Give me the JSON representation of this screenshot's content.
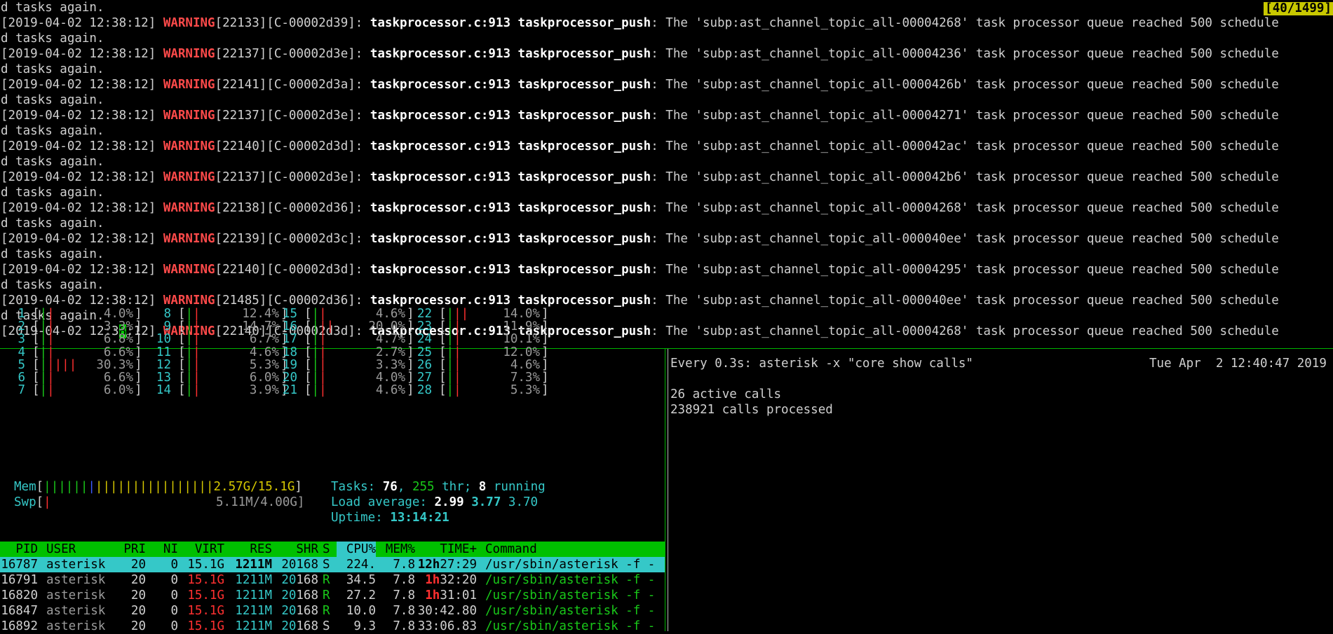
{
  "log": {
    "position_badge": "[40/1499]",
    "first_line": "d tasks again.",
    "wrap_tail": "d tasks again.",
    "entries": [
      {
        "ts": "[2019-04-02 12:38:12]",
        "level": "WARNING",
        "ids": "[22133][C-00002d39]:",
        "src": "taskprocessor.c:913 taskprocessor_push",
        "msg": ": The 'subp:ast_channel_topic_all-00004268' task processor queue reached 500 schedule"
      },
      {
        "ts": "[2019-04-02 12:38:12]",
        "level": "WARNING",
        "ids": "[22137][C-00002d3e]:",
        "src": "taskprocessor.c:913 taskprocessor_push",
        "msg": ": The 'subp:ast_channel_topic_all-00004236' task processor queue reached 500 schedule"
      },
      {
        "ts": "[2019-04-02 12:38:12]",
        "level": "WARNING",
        "ids": "[22141][C-00002d3a]:",
        "src": "taskprocessor.c:913 taskprocessor_push",
        "msg": ": The 'subp:ast_channel_topic_all-0000426b' task processor queue reached 500 schedule"
      },
      {
        "ts": "[2019-04-02 12:38:12]",
        "level": "WARNING",
        "ids": "[22137][C-00002d3e]:",
        "src": "taskprocessor.c:913 taskprocessor_push",
        "msg": ": The 'subp:ast_channel_topic_all-00004271' task processor queue reached 500 schedule"
      },
      {
        "ts": "[2019-04-02 12:38:12]",
        "level": "WARNING",
        "ids": "[22140][C-00002d3d]:",
        "src": "taskprocessor.c:913 taskprocessor_push",
        "msg": ": The 'subp:ast_channel_topic_all-000042ac' task processor queue reached 500 schedule"
      },
      {
        "ts": "[2019-04-02 12:38:12]",
        "level": "WARNING",
        "ids": "[22137][C-00002d3e]:",
        "src": "taskprocessor.c:913 taskprocessor_push",
        "msg": ": The 'subp:ast_channel_topic_all-000042b6' task processor queue reached 500 schedule"
      },
      {
        "ts": "[2019-04-02 12:38:12]",
        "level": "WARNING",
        "ids": "[22138][C-00002d36]:",
        "src": "taskprocessor.c:913 taskprocessor_push",
        "msg": ": The 'subp:ast_channel_topic_all-00004268' task processor queue reached 500 schedule"
      },
      {
        "ts": "[2019-04-02 12:38:12]",
        "level": "WARNING",
        "ids": "[22139][C-00002d3c]:",
        "src": "taskprocessor.c:913 taskprocessor_push",
        "msg": ": The 'subp:ast_channel_topic_all-000040ee' task processor queue reached 500 schedule"
      },
      {
        "ts": "[2019-04-02 12:38:12]",
        "level": "WARNING",
        "ids": "[22140][C-00002d3d]:",
        "src": "taskprocessor.c:913 taskprocessor_push",
        "msg": ": The 'subp:ast_channel_topic_all-00004295' task processor queue reached 500 schedule"
      },
      {
        "ts": "[2019-04-02 12:38:12]",
        "level": "WARNING",
        "ids": "[21485][C-00002d36]:",
        "src": "taskprocessor.c:913 taskprocessor_push",
        "msg": ": The 'subp:ast_channel_topic_all-000040ee' task processor queue reached 500 schedule"
      }
    ],
    "last_entry": {
      "ts_a": "[2019-04-02 12:3",
      "ts_cursor": "8",
      "ts_b": ":12]",
      "level": "WARNING",
      "ids": "[22140][C-00002d3d]:",
      "src": "taskprocessor.c:913 taskprocessor_push",
      "msg": ": The 'subp:ast_channel_topic_all-00004268' task processor queue reached 500 schedule"
    }
  },
  "htop": {
    "cpus": [
      {
        "n": "1",
        "bar": "||",
        "pct": "4.0%"
      },
      {
        "n": "2",
        "bar": "||",
        "pct": "3.3%"
      },
      {
        "n": "3",
        "bar": "||",
        "pct": "6.8%"
      },
      {
        "n": "4",
        "bar": "||",
        "pct": "6.6%"
      },
      {
        "n": "5",
        "bar": "|||||",
        "pct": "30.3%"
      },
      {
        "n": "6",
        "bar": "||",
        "pct": "6.6%"
      },
      {
        "n": "7",
        "bar": "||",
        "pct": "6.0%"
      },
      {
        "n": "8",
        "bar": "||",
        "pct": "12.4%"
      },
      {
        "n": "9",
        "bar": "||",
        "pct": "14.7%"
      },
      {
        "n": "10",
        "bar": "||",
        "pct": "6.7%"
      },
      {
        "n": "11",
        "bar": "||",
        "pct": "4.6%"
      },
      {
        "n": "12",
        "bar": "||",
        "pct": "5.3%"
      },
      {
        "n": "13",
        "bar": "||",
        "pct": "6.0%"
      },
      {
        "n": "14",
        "bar": "||",
        "pct": "3.9%"
      },
      {
        "n": "15",
        "bar": "||",
        "pct": "4.6%"
      },
      {
        "n": "16",
        "bar": "|||",
        "pct": "20.0%"
      },
      {
        "n": "17",
        "bar": "||",
        "pct": "4.7%"
      },
      {
        "n": "18",
        "bar": "||",
        "pct": "2.7%"
      },
      {
        "n": "19",
        "bar": "||",
        "pct": "3.3%"
      },
      {
        "n": "20",
        "bar": "||",
        "pct": "4.0%"
      },
      {
        "n": "21",
        "bar": "||",
        "pct": "4.6%"
      },
      {
        "n": "22",
        "bar": "|||",
        "pct": "14.0%"
      },
      {
        "n": "23",
        "bar": "||",
        "pct": "11.9%"
      },
      {
        "n": "24",
        "bar": "||",
        "pct": "10.1%"
      },
      {
        "n": "25",
        "bar": "||",
        "pct": "12.0%"
      },
      {
        "n": "26",
        "bar": "||",
        "pct": "4.6%"
      },
      {
        "n": "27",
        "bar": "||",
        "pct": "7.3%"
      },
      {
        "n": "28",
        "bar": "||",
        "pct": "5.3%"
      }
    ],
    "mem": {
      "label": "Mem",
      "bar_green": "||||||",
      "bar_blue": "|",
      "bar_yellow": "||||||||||||||||",
      "value": "2.57G/15.1G"
    },
    "swp": {
      "label": "Swp",
      "bar_red": "|",
      "value": "5.11M/4.00G"
    },
    "tasks": {
      "label": "Tasks:",
      "count": "76",
      "sep": ",",
      "threads": "255",
      "thr": "thr;",
      "running": "8",
      "running_label": "running"
    },
    "load": {
      "label": "Load average:",
      "l1": "2.99",
      "l5": "3.77",
      "l15": "3.70"
    },
    "uptime": {
      "label": "Uptime:",
      "value": "13:14:21"
    },
    "columns": [
      "PID",
      "USER",
      "PRI",
      "NI",
      "VIRT",
      "RES",
      "SHR",
      "S",
      "CPU%",
      "MEM%",
      "TIME+",
      "Command"
    ],
    "sort_column": "CPU%",
    "processes": [
      {
        "pid": "16787",
        "user": "asterisk",
        "pri": "20",
        "ni": "0",
        "virt": "15.1G",
        "res": "1211M",
        "shr_a": "20",
        "shr_b": "168",
        "s": "S",
        "cpu": "224.",
        "mem": "7.8",
        "time_a": "12h",
        "time_b": "27:29",
        "cmd": "/usr/sbin/asterisk -f -"
      },
      {
        "pid": "16791",
        "user": "asterisk",
        "pri": "20",
        "ni": "0",
        "virt": "15.1G",
        "res": "1211M",
        "shr_a": "20",
        "shr_b": "168",
        "s": "R",
        "cpu": "34.5",
        "mem": "7.8",
        "time_a": "1h",
        "time_b": "32:20",
        "cmd": "/usr/sbin/asterisk -f -"
      },
      {
        "pid": "16820",
        "user": "asterisk",
        "pri": "20",
        "ni": "0",
        "virt": "15.1G",
        "res": "1211M",
        "shr_a": "20",
        "shr_b": "168",
        "s": "R",
        "cpu": "27.2",
        "mem": "7.8",
        "time_a": "1h",
        "time_b": "31:01",
        "cmd": "/usr/sbin/asterisk -f -"
      },
      {
        "pid": "16847",
        "user": "asterisk",
        "pri": "20",
        "ni": "0",
        "virt": "15.1G",
        "res": "1211M",
        "shr_a": "20",
        "shr_b": "168",
        "s": "R",
        "cpu": "10.0",
        "mem": "7.8",
        "time_a": "",
        "time_b": "30:42.80",
        "cmd": "/usr/sbin/asterisk -f -"
      },
      {
        "pid": "16892",
        "user": "asterisk",
        "pri": "20",
        "ni": "0",
        "virt": "15.1G",
        "res": "1211M",
        "shr_a": "20",
        "shr_b": "168",
        "s": "S",
        "cpu": "9.3",
        "mem": "7.8",
        "time_a": "",
        "time_b": "33:06.83",
        "cmd": "/usr/sbin/asterisk -f -"
      }
    ]
  },
  "watch": {
    "header": "Every 0.3s: asterisk -x \"core show calls\"",
    "datetime": "Tue Apr  2 12:40:47 2019",
    "active_calls": "26 active calls",
    "calls_processed": "238921 calls processed"
  }
}
